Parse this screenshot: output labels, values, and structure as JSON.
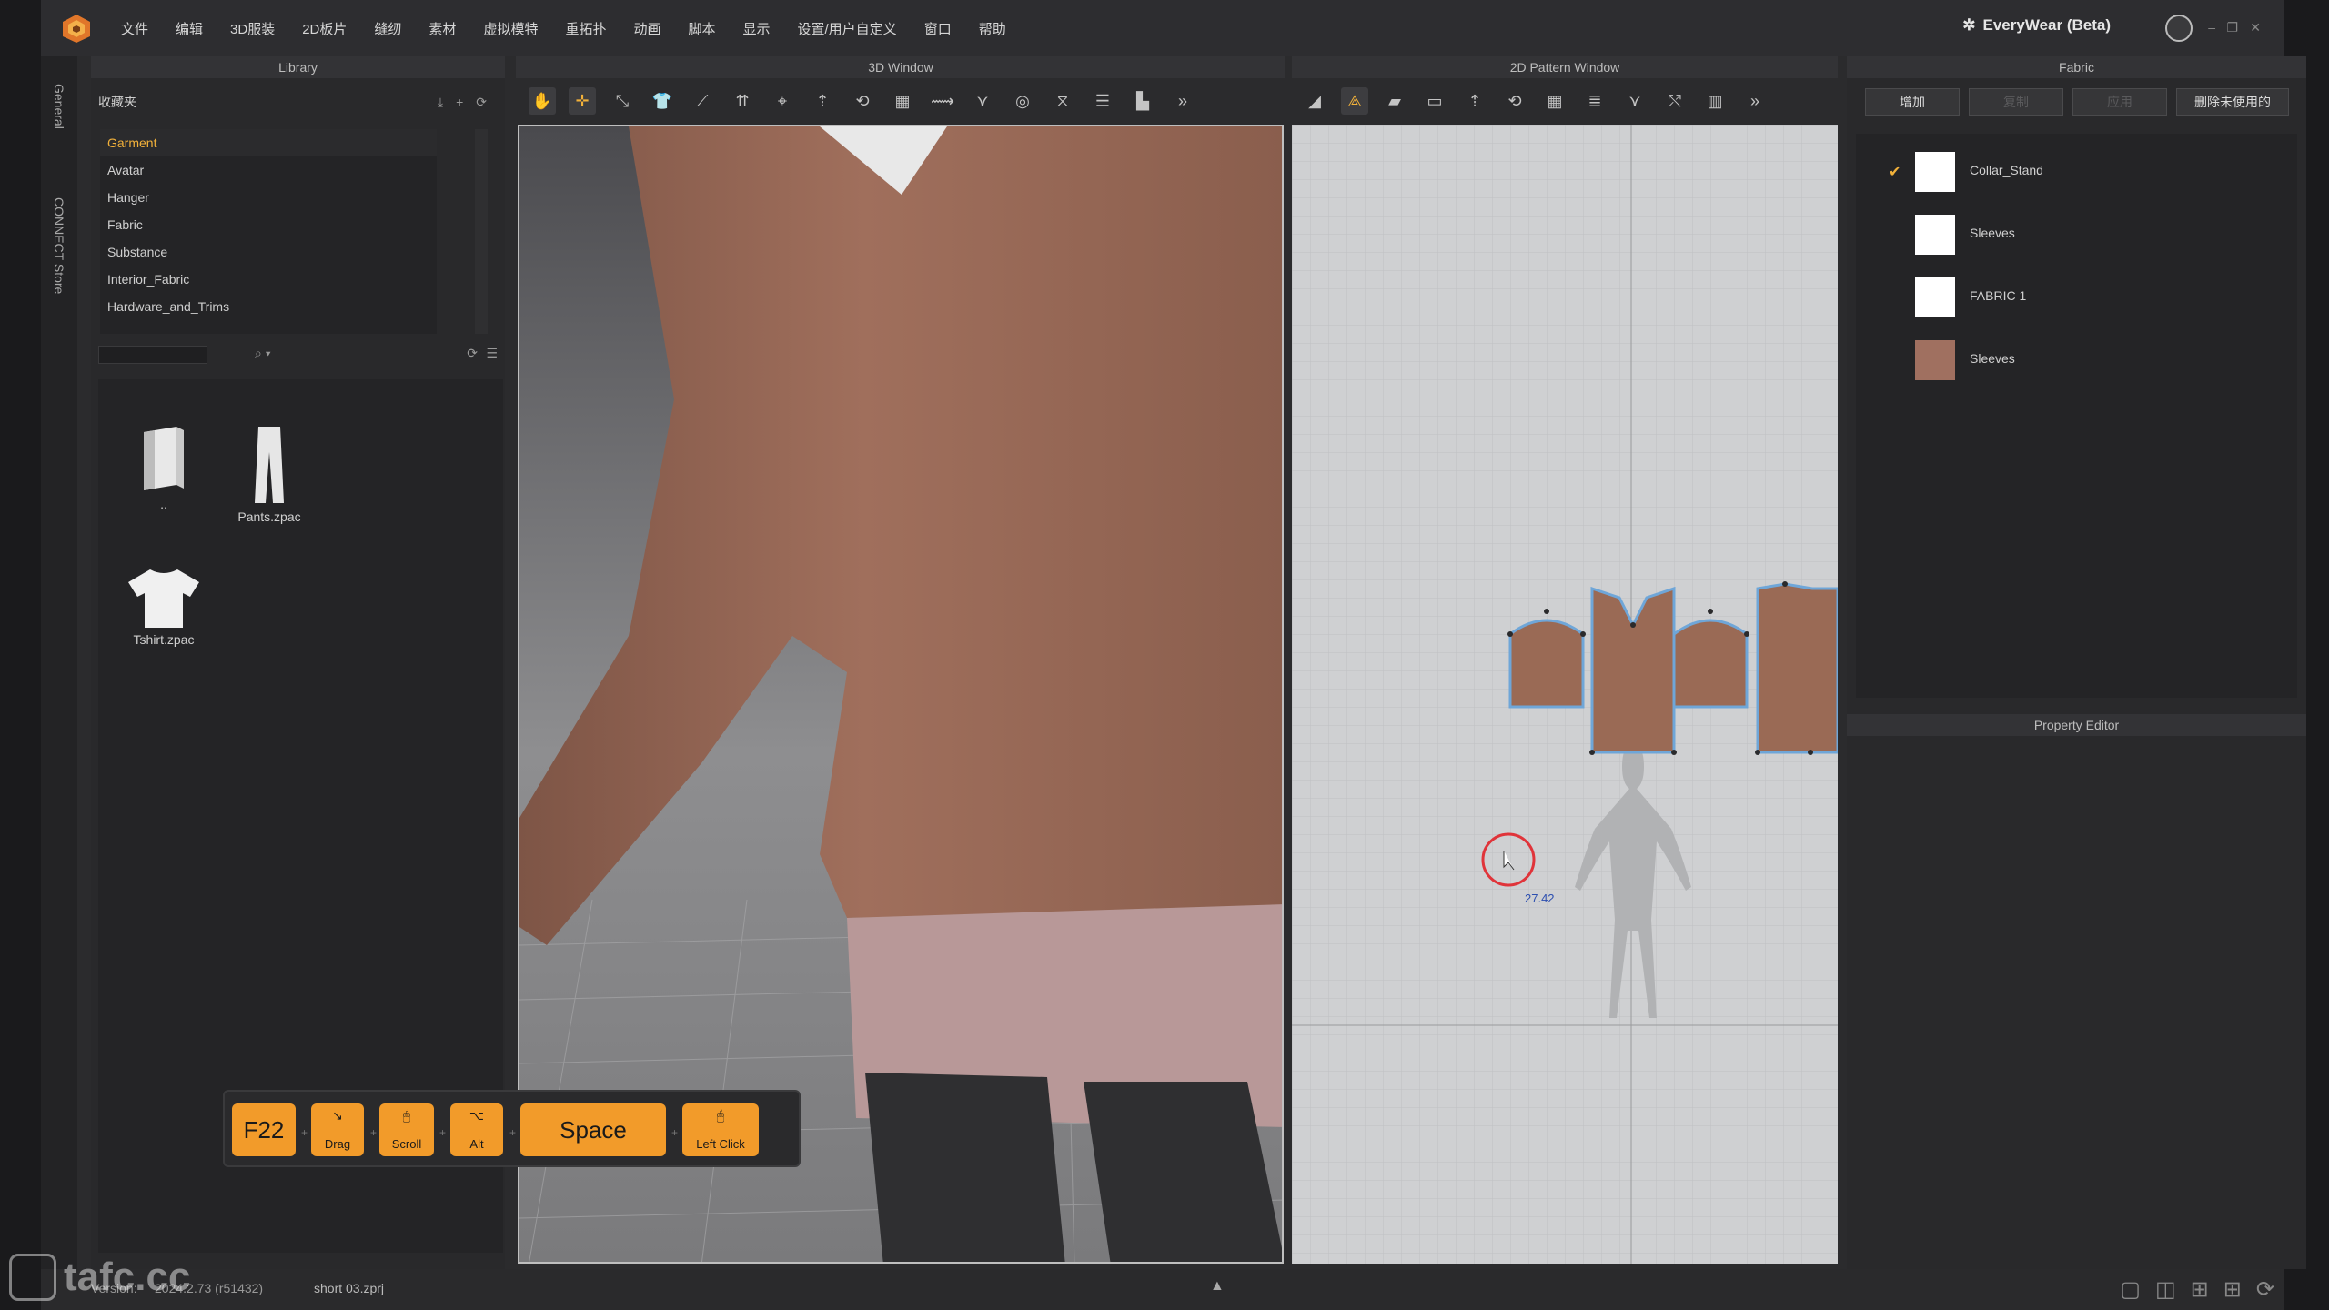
{
  "menubar": {
    "items": [
      "文件",
      "编辑",
      "3D服装",
      "2D板片",
      "缝纫",
      "素材",
      "虚拟模特",
      "重拓扑",
      "动画",
      "脚本",
      "显示",
      "设置/用户自定义",
      "窗口",
      "帮助"
    ],
    "brand": "EveryWear (Beta)"
  },
  "sidebar": {
    "tabs": [
      "General",
      "CONNECT Store"
    ]
  },
  "library": {
    "title": "Library",
    "favorites_label": "收藏夹",
    "tree": [
      "Garment",
      "Avatar",
      "Hanger",
      "Fabric",
      "Substance",
      "Interior_Fabric",
      "Hardware_and_Trims"
    ],
    "selected": "Garment",
    "search_placeholder": "",
    "files": [
      {
        "name": ".."
      },
      {
        "name": "Pants.zpac"
      },
      {
        "name": "Tshirt.zpac"
      }
    ]
  },
  "view3d": {
    "title": "3D Window"
  },
  "view2d": {
    "title": "2D Pattern Window",
    "measure": "27.42"
  },
  "fabric": {
    "title": "Fabric",
    "buttons": [
      "增加",
      "复制",
      "应用",
      "删除未使用的"
    ],
    "items": [
      {
        "name": "Collar_Stand",
        "color": "#ffffff",
        "checked": true
      },
      {
        "name": "Sleeves",
        "color": "#ffffff",
        "checked": false
      },
      {
        "name": "FABRIC 1",
        "color": "#ffffff",
        "checked": false
      },
      {
        "name": "Sleeves",
        "color": "#a07060",
        "checked": false
      }
    ]
  },
  "property_editor": {
    "title": "Property Editor"
  },
  "status": {
    "version_label": "Version:",
    "version": "2024.2.73 (r51432)",
    "file": "short 03.zprj"
  },
  "keys": [
    {
      "label": "F22",
      "sub": "",
      "icon": ""
    },
    {
      "label": "",
      "sub": "Drag",
      "icon": "↘"
    },
    {
      "label": "",
      "sub": "Scroll",
      "icon": "🖱"
    },
    {
      "label": "",
      "sub": "Alt",
      "icon": "⌥"
    },
    {
      "label": "Space",
      "sub": "",
      "icon": ""
    },
    {
      "label": "",
      "sub": "Left Click",
      "icon": "🖱"
    }
  ],
  "watermark": "tafc.cc",
  "colors": {
    "accent": "#f2b13a",
    "key": "#f29b2a",
    "cloth": "#9a6a55"
  }
}
